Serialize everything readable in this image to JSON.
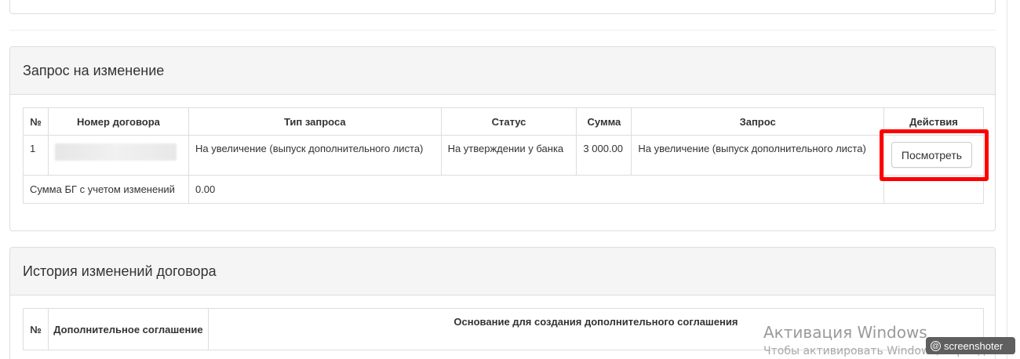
{
  "request_panel": {
    "title": "Запрос на изменение",
    "headers": [
      "№",
      "Номер договора",
      "Тип запроса",
      "Статус",
      "Сумма",
      "Запрос",
      "Действия"
    ],
    "row": {
      "num": "1",
      "contract_number": "",
      "request_type": "На увеличение (выпуск дополнительного листа)",
      "status": "На утверждении у банка",
      "amount": "3 000.00",
      "request": "На увеличение (выпуск дополнительного листа)",
      "action_label": "Посмотреть"
    },
    "total_label": "Сумма БГ с учетом изменений",
    "total_value": "0.00"
  },
  "history_panel": {
    "title": "История изменений договора",
    "headers": [
      "№",
      "Дополнительное соглашение",
      "Основание для создания дополнительного соглашения"
    ]
  },
  "watermark": {
    "title": "Активация Windows",
    "subtitle": "Чтобы активировать Windows, перейдите в"
  },
  "badge": {
    "label": "screenshoter"
  },
  "colors": {
    "highlight": "#ff0000",
    "heading_bg": "#f5f5f5",
    "border": "#dddddd"
  }
}
